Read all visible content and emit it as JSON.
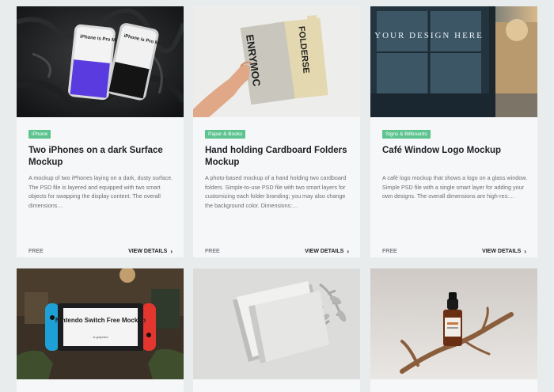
{
  "accent_color": "#5ec48f",
  "cards": [
    {
      "category": "iPhone",
      "title": "Two iPhones on a dark Surface Mockup",
      "description": "A mockup of two iPhones laying on a dark, dusty surface. The PSD file is layered and equipped with two smart objects for swapping the display content. The overall dimensions…",
      "price": "FREE",
      "cta": "VIEW DETAILS",
      "image_text": {
        "phone_left": "iPhone is Pro Mockup",
        "phone_right": "iPhone is Pro Mockup"
      }
    },
    {
      "category": "Paper & Books",
      "title": "Hand holding Cardboard Folders Mockup",
      "description": "A photo-based mockup of a hand holding two cardboard folders. Simple-to-use PSD file with two smart layers for customizing each folder branding; you may also change the background color. Dimensions:…",
      "price": "FREE",
      "cta": "VIEW DETAILS",
      "image_text": {
        "folder_front": "ENRYMOC",
        "folder_back": "FOLDERSE"
      }
    },
    {
      "category": "Signs & Billboards",
      "title": "Café Window Logo Mockup",
      "description": "A café logo mockup that shows a logo on a glass window. Simple PSD file with a single smart layer for adding your own designs. The overall dimensions are high-res:…",
      "price": "FREE",
      "cta": "VIEW DETAILS",
      "image_text": {
        "window": "YOUR DESIGN HERE"
      }
    },
    {
      "image_text": {
        "screen_title": "Nintendo Switch Free Mockup",
        "screen_sub": "ls.graphics"
      }
    },
    {
      "image_text": {}
    },
    {
      "image_text": {}
    }
  ]
}
